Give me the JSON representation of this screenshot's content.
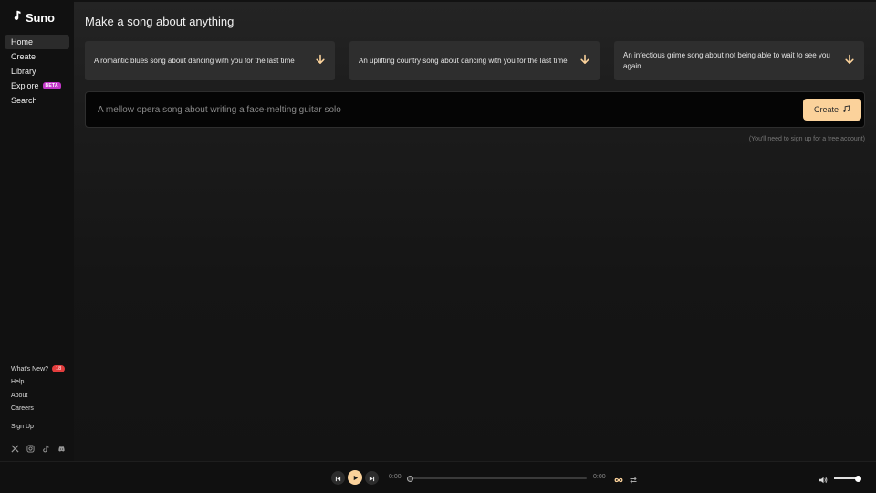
{
  "brand": {
    "name": "Suno"
  },
  "nav": {
    "items": [
      {
        "label": "Home",
        "active": true
      },
      {
        "label": "Create"
      },
      {
        "label": "Library"
      },
      {
        "label": "Explore",
        "badge": "BETA"
      },
      {
        "label": "Search"
      }
    ]
  },
  "footer_links": {
    "whats_new": "What's New?",
    "whats_new_count": "18",
    "help": "Help",
    "about": "About",
    "careers": "Careers",
    "signup": "Sign Up"
  },
  "socials": [
    "x-icon",
    "instagram-icon",
    "tiktok-icon",
    "discord-icon"
  ],
  "main": {
    "title": "Make a song about anything",
    "suggestions": [
      "A romantic blues song about dancing with you for the last time",
      "An uplifting country song about dancing with you for the last time",
      "An infectious grime song about not being able to wait to see you again"
    ],
    "prompt_placeholder": "A mellow opera song about writing a face-melting guitar solo",
    "create_label": "Create",
    "note": "(You'll need to sign up for a free account)"
  },
  "player": {
    "current_time": "0:00",
    "duration": "0:00",
    "progress": 0,
    "volume": 1.0
  },
  "colors": {
    "accent": "#fbd29b",
    "beta_badge": "#c237c8",
    "count_badge": "#e33d3d",
    "background": "#121212"
  }
}
